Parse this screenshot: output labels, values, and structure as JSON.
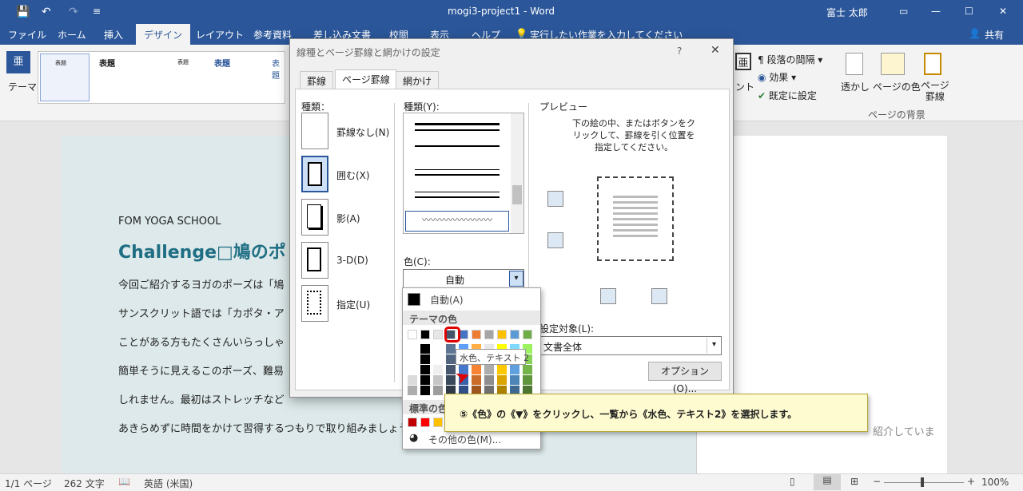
{
  "titlebar": {
    "doc_title": "mogi3-project1  -  Word",
    "user": "富士 太郎"
  },
  "tabs": [
    "ファイル",
    "ホーム",
    "挿入",
    "デザイン",
    "レイアウト",
    "参考資料",
    "差し込み文書",
    "校閲",
    "表示",
    "ヘルプ"
  ],
  "tell_me": "実行したい作業を入力してください",
  "share": "共有",
  "ribbon": {
    "theme": "テーマ",
    "styles": [
      "表題",
      "表題",
      "表題",
      "表題",
      "表題"
    ],
    "para_spacing": "段落の間隔",
    "effects": "効果",
    "set_default": "既定に設定",
    "font_partial": "ント",
    "watermark": "透かし",
    "page_color": "ページの色",
    "page_borders": "ページ\n罫線",
    "page_bg_group": "ページの背景"
  },
  "document": {
    "school": "FOM YOGA SCHOOL",
    "title": "Challenge□鳩のポ",
    "lines": [
      "今回ご紹介するヨガのポーズは「鳩",
      "サンスクリット語では「カポタ・ア",
      "ことがある方もたくさんいらっしゃ",
      "簡単そうに見えるこのポーズ、難易",
      "しれません。最初はストレッチなど",
      "あきらめずに時間をかけて習得するつもりで取り組みましょう。"
    ],
    "right_text": "紹介していま"
  },
  "dialog": {
    "title": "線種とページ罫線と網かけの設定",
    "help": "?",
    "close": "✕",
    "tabs": [
      "罫線",
      "ページ罫線",
      "網かけ"
    ],
    "settings_label": "種類：",
    "settings": [
      "罫線なし(N)",
      "囲む(X)",
      "影(A)",
      "3-D(D)",
      "指定(U)"
    ],
    "style_label": "種類(Y):",
    "color_label": "色(C):",
    "color_value": "自動",
    "preview_label": "プレビュー",
    "preview_text": "下の絵の中、またはボタンをクリックして、罫線を引く位置を指定してください。",
    "apply_label": "設定対象(L):",
    "apply_value": "文書全体",
    "options_button": "オプション(O)..."
  },
  "palette": {
    "auto": "自動(A)",
    "theme_header": "テーマの色",
    "tooltip": "水色、テキスト 2",
    "standard_header": "標準の色",
    "more_colors": "その他の色(M)...",
    "theme_colors": [
      "#ffffff",
      "#000000",
      "#e7e6e6",
      "#44546a",
      "#4472c4",
      "#ed7d31",
      "#a5a5a5",
      "#ffc000",
      "#5b9bd5",
      "#70ad47"
    ],
    "standard_colors": [
      "#c00000",
      "#ff0000",
      "#ffc000"
    ]
  },
  "callout": "⑤《色》の《▼》をクリックし、一覧から《水色、テキスト2》を選択します。",
  "status": {
    "page": "1/1 ページ",
    "words": "262 文字",
    "lang": "英語 (米国)",
    "zoom": "100%"
  }
}
